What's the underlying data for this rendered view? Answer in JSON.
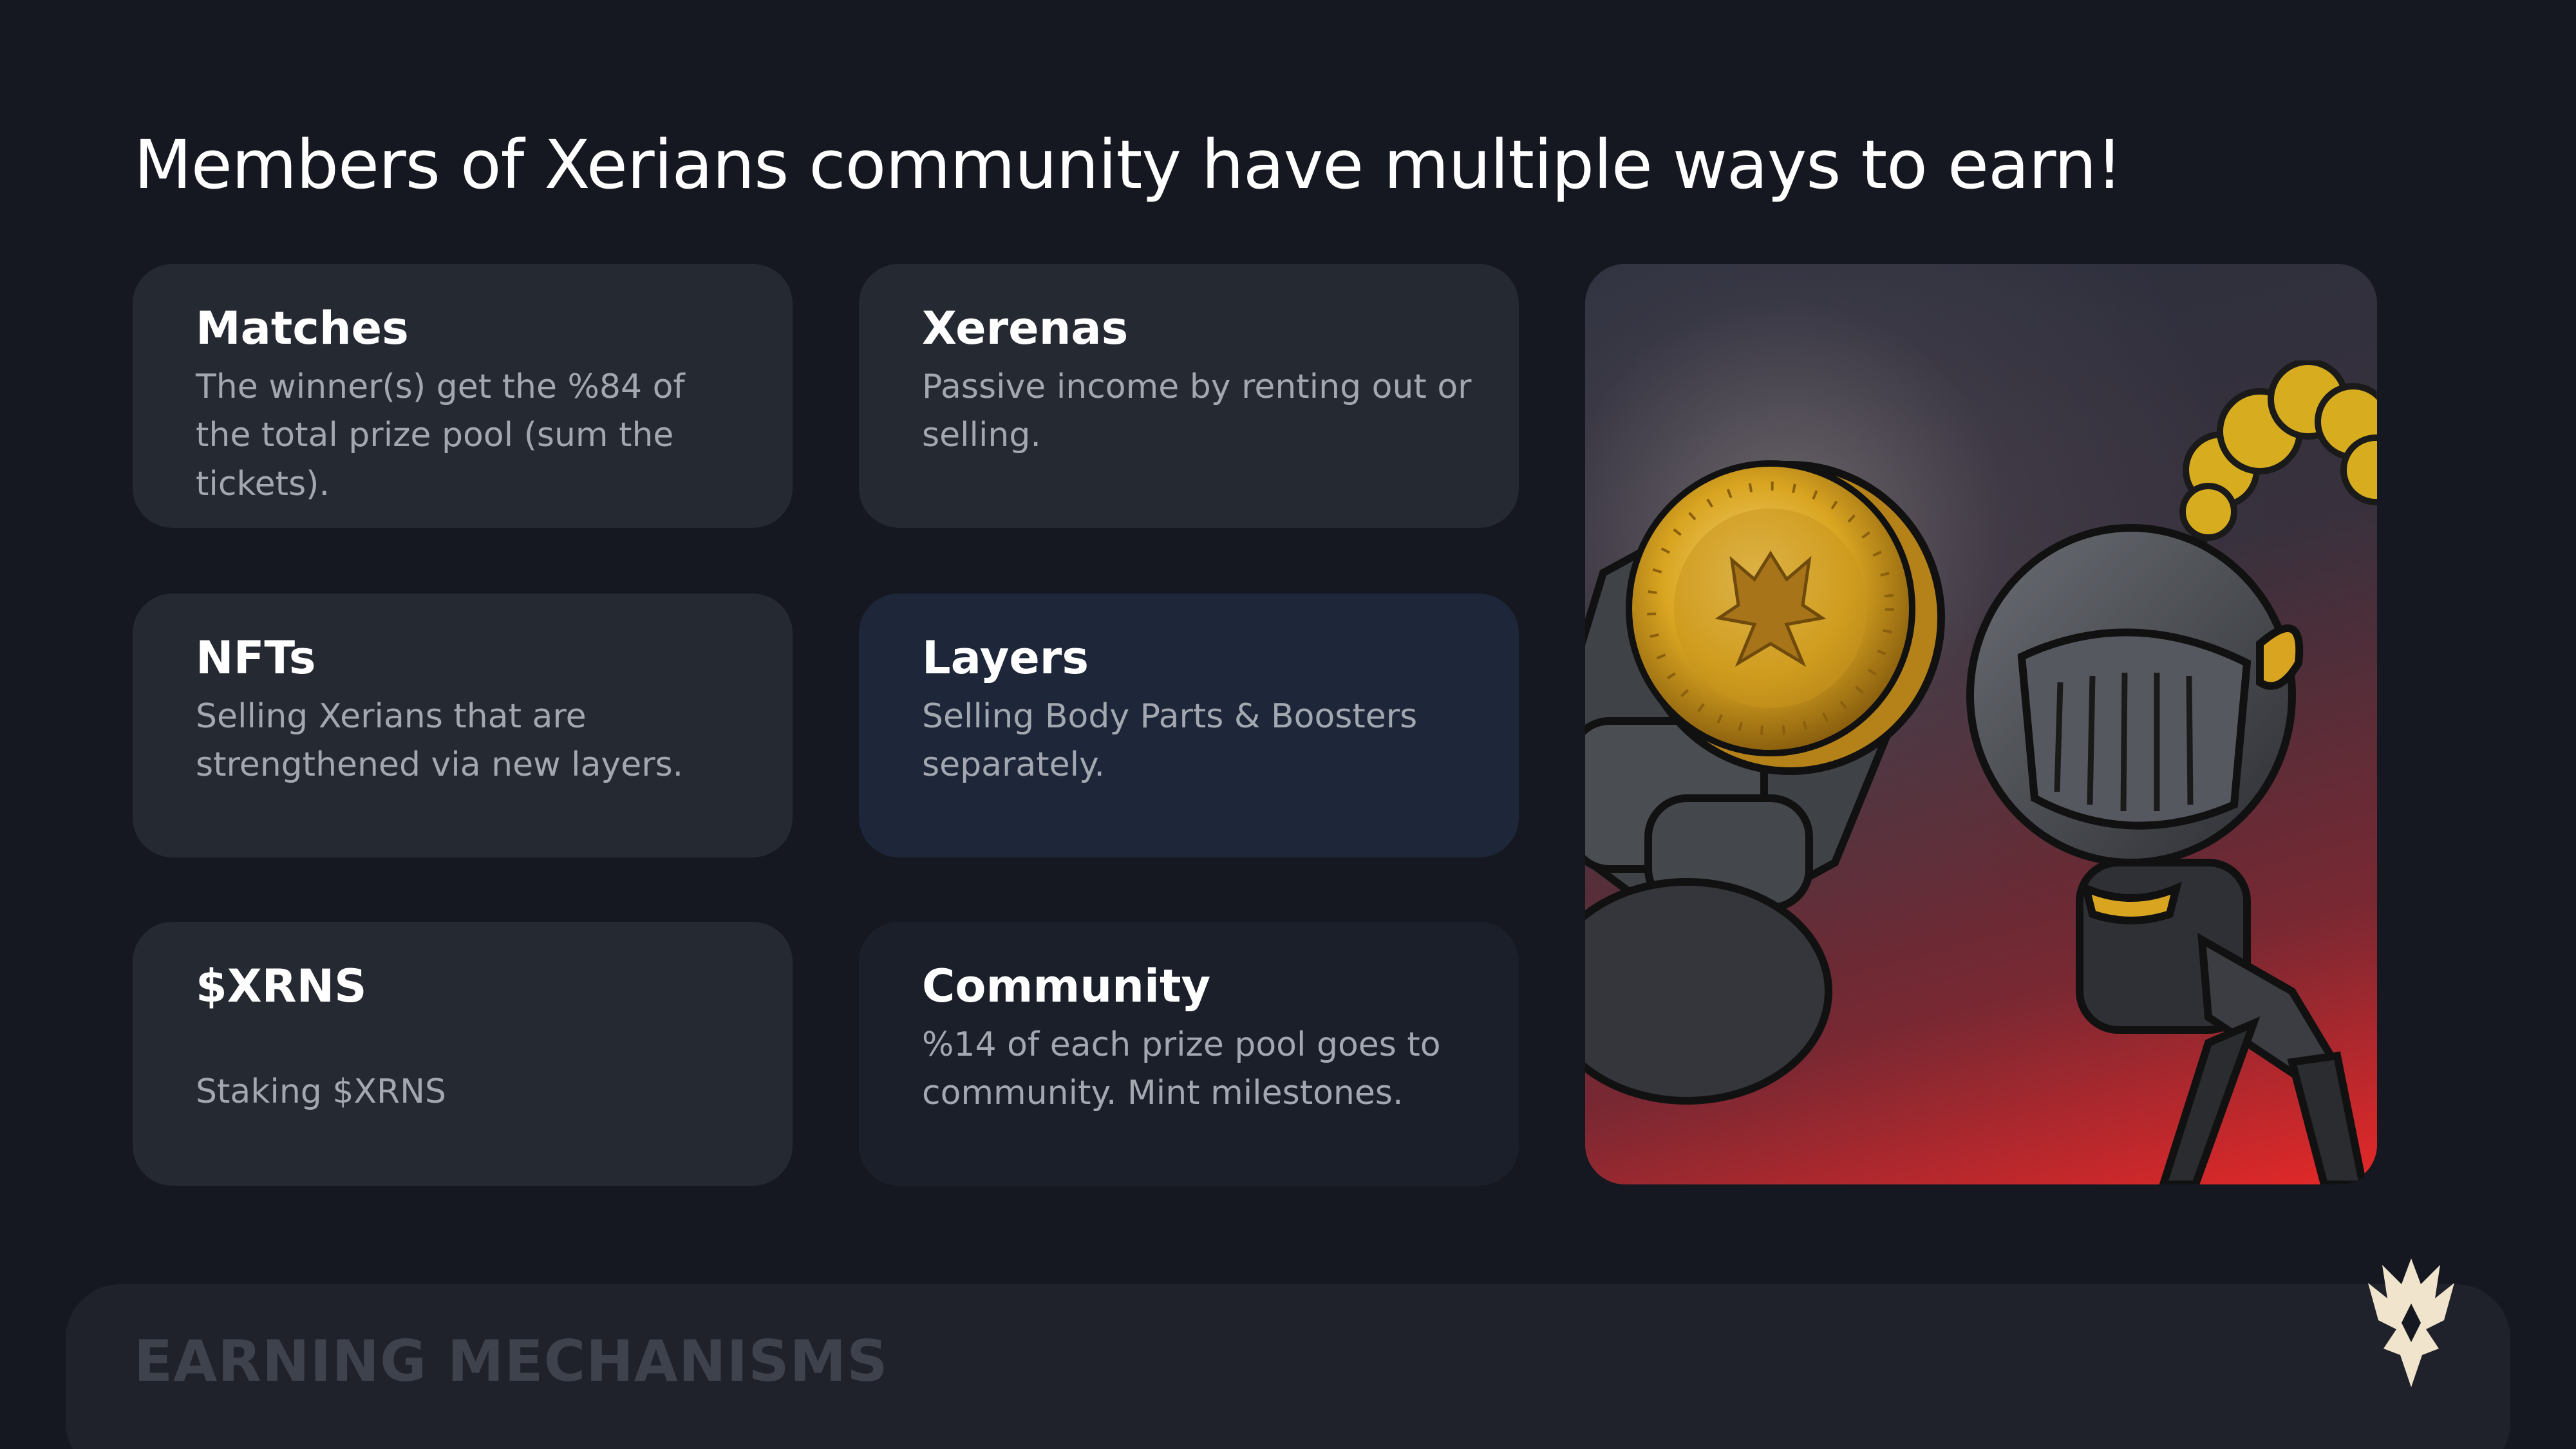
{
  "headline": "Members of Xerians community have multiple ways to earn!",
  "cards": [
    {
      "title": "Matches",
      "text": "The winner(s) get the %84 of the total prize pool (sum the tickets)."
    },
    {
      "title": "Xerenas",
      "text": "Passive income by renting out or selling."
    },
    {
      "title": "NFTs",
      "text": "Selling Xerians that are strengthened via new layers."
    },
    {
      "title": "Layers",
      "text": "Selling Body Parts & Boosters separately."
    },
    {
      "title": "$XRNS",
      "text": "Staking $XRNS"
    },
    {
      "title": "Community",
      "text": "%14 of each prize pool goes to community. Mint milestones."
    }
  ],
  "footer": {
    "label": "EARNING MECHANISMS"
  },
  "icons": {
    "brand_logo": "crown-logo-icon",
    "coin_emblem": "crown-coin-icon"
  },
  "colors": {
    "background": "#151820",
    "card": "#252932",
    "card_dark": "#1b1f2a",
    "card_highlight": "#1e2739",
    "title_text": "#ffffff",
    "body_text": "#a3a7b0",
    "gold": "#d9a521",
    "footer_text": "#3e424d"
  }
}
